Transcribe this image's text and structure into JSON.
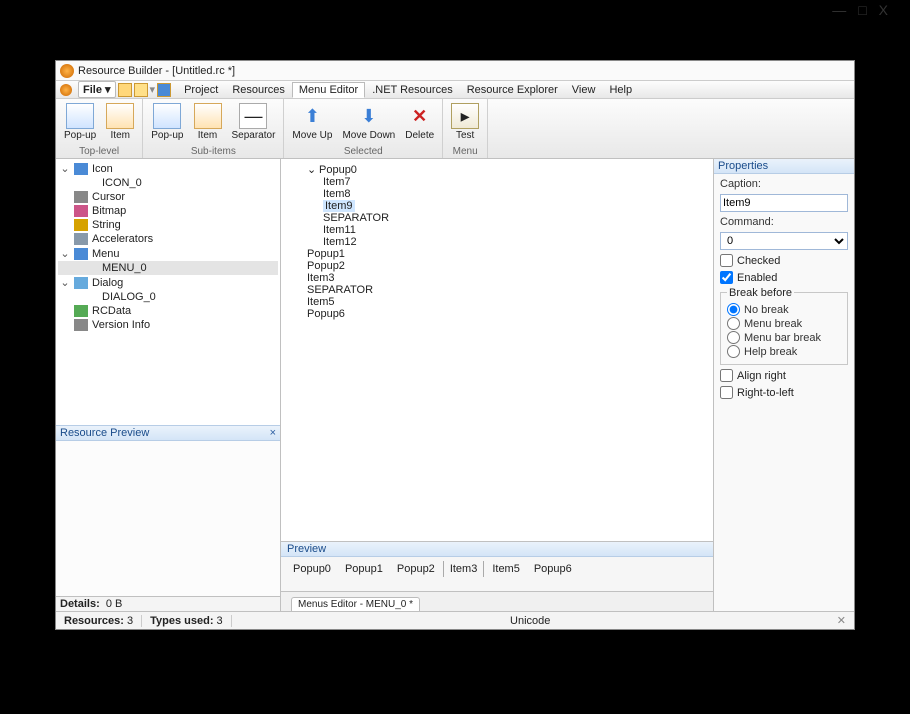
{
  "window": {
    "title": "Resource Builder - [Untitled.rc *]",
    "sys_min": "—",
    "sys_max": "□",
    "sys_close": "X"
  },
  "menubar": {
    "file": "File",
    "tabs": [
      "Project",
      "Resources",
      "Menu Editor",
      ".NET Resources",
      "Resource Explorer",
      "View",
      "Help"
    ],
    "active_index": 2
  },
  "ribbon": {
    "groups": [
      {
        "name": "Top-level",
        "buttons": [
          {
            "id": "popup-top",
            "label": "Pop-up"
          },
          {
            "id": "item-top",
            "label": "Item"
          }
        ]
      },
      {
        "name": "Sub-items",
        "buttons": [
          {
            "id": "popup-sub",
            "label": "Pop-up"
          },
          {
            "id": "item-sub",
            "label": "Item"
          },
          {
            "id": "separator",
            "label": "Separator"
          }
        ]
      },
      {
        "name": "Selected",
        "buttons": [
          {
            "id": "move-up",
            "label": "Move Up"
          },
          {
            "id": "move-down",
            "label": "Move Down"
          },
          {
            "id": "delete",
            "label": "Delete"
          }
        ]
      },
      {
        "name": "Menu",
        "buttons": [
          {
            "id": "test",
            "label": "Test"
          }
        ]
      }
    ]
  },
  "resource_tree": {
    "items": [
      {
        "label": "Icon",
        "icon": "icon-resource",
        "expanded": true,
        "children": [
          {
            "label": "ICON_0"
          }
        ]
      },
      {
        "label": "Cursor",
        "icon": "cursor-resource"
      },
      {
        "label": "Bitmap",
        "icon": "bitmap-resource"
      },
      {
        "label": "String",
        "icon": "string-resource"
      },
      {
        "label": "Accelerators",
        "icon": "accel-resource"
      },
      {
        "label": "Menu",
        "icon": "menu-resource",
        "expanded": true,
        "children": [
          {
            "label": "MENU_0",
            "selected": true
          }
        ]
      },
      {
        "label": "Dialog",
        "icon": "dialog-resource",
        "expanded": true,
        "children": [
          {
            "label": "DIALOG_0"
          }
        ]
      },
      {
        "label": "RCData",
        "icon": "rcdata-resource"
      },
      {
        "label": "Version Info",
        "icon": "version-resource"
      }
    ]
  },
  "resource_preview": {
    "title": "Resource Preview"
  },
  "details": {
    "label": "Details:",
    "value": "0 B"
  },
  "status": {
    "resources_label": "Resources:",
    "resources_value": "3",
    "types_label": "Types used:",
    "types_value": "3",
    "encoding": "Unicode"
  },
  "menu_tree": {
    "nodes": [
      {
        "label": "Popup0",
        "level": 1,
        "caret": "v"
      },
      {
        "label": "Item7",
        "level": 2
      },
      {
        "label": "Item8",
        "level": 2
      },
      {
        "label": "Item9",
        "level": 2,
        "selected": true
      },
      {
        "label": "SEPARATOR",
        "level": 2
      },
      {
        "label": "Item11",
        "level": 2
      },
      {
        "label": "Item12",
        "level": 2
      },
      {
        "label": "Popup1",
        "level": 1
      },
      {
        "label": "Popup2",
        "level": 1
      },
      {
        "label": "Item3",
        "level": 1
      },
      {
        "label": "SEPARATOR",
        "level": 1
      },
      {
        "label": "Item5",
        "level": 1
      },
      {
        "label": "Popup6",
        "level": 1
      }
    ]
  },
  "preview": {
    "title": "Preview",
    "items": [
      "Popup0",
      "Popup1",
      "Popup2",
      "Item3",
      "Item5",
      "Popup6"
    ]
  },
  "doc_tab": {
    "label": "Menus Editor - MENU_0 *"
  },
  "properties": {
    "title": "Properties",
    "caption_label": "Caption:",
    "caption_value": "Item9",
    "command_label": "Command:",
    "command_value": "0",
    "checked_label": "Checked",
    "checked_value": false,
    "enabled_label": "Enabled",
    "enabled_value": true,
    "break_legend": "Break before",
    "break_options": [
      "No break",
      "Menu break",
      "Menu bar break",
      "Help break"
    ],
    "break_selected": 0,
    "align_right_label": "Align right",
    "align_right_value": false,
    "rtl_label": "Right-to-left",
    "rtl_value": false
  }
}
